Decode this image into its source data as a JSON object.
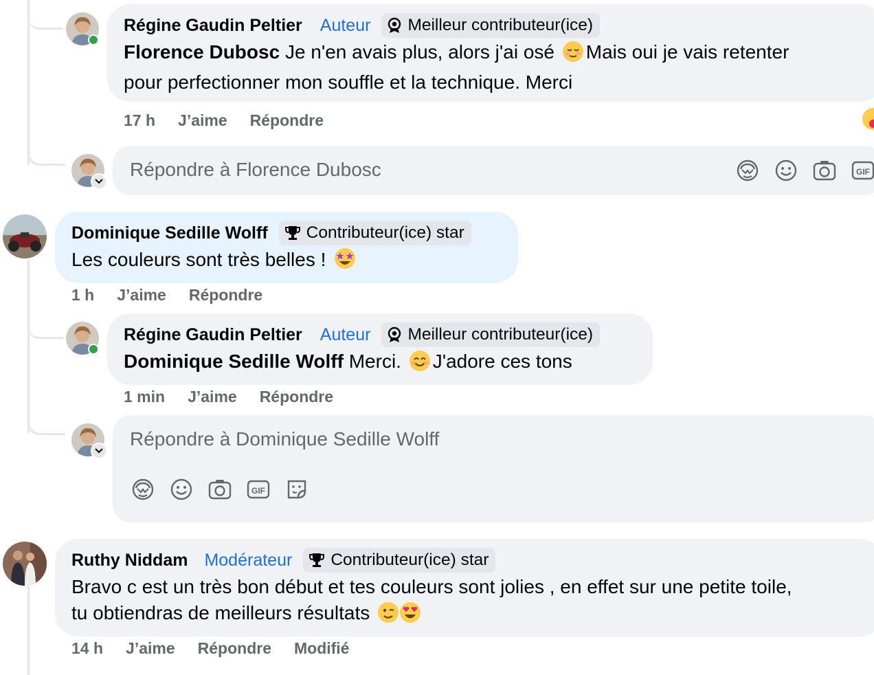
{
  "thread": [
    {
      "author": "Régine Gaudin Peltier",
      "role": "Auteur",
      "badge": "Meilleur contributeur(ice)",
      "mention": "Florence Dubosc",
      "text_1": "Je n'en avais plus, alors j'ai osé",
      "text_2": "Mais oui je vais retenter",
      "text_3": "pour perfectionner mon souffle et la technique. Merci",
      "time": "17 h",
      "like": "J’aime",
      "reply": "Répondre"
    },
    {
      "reply_placeholder": "Répondre à Florence Dubosc"
    },
    {
      "author": "Dominique Sedille Wolff",
      "badge": "Contributeur(ice) star",
      "text": "Les couleurs sont très belles !",
      "time": "1 h",
      "like": "J’aime",
      "reply": "Répondre"
    },
    {
      "author": "Régine Gaudin Peltier",
      "role": "Auteur",
      "badge": "Meilleur contributeur(ice)",
      "mention": "Dominique Sedille Wolff",
      "text_1": "Merci.",
      "text_2": "J'adore ces tons",
      "time": "1 min",
      "like": "J’aime",
      "reply": "Répondre"
    },
    {
      "reply_placeholder": "Répondre à Dominique Sedille Wolff"
    },
    {
      "author": "Ruthy Niddam",
      "role": "Modérateur",
      "badge": "Contributeur(ice) star",
      "text_1": "Bravo c est un très bon début et tes couleurs sont jolies , en effet sur une petite toile,",
      "text_2": "tu obtiendras de meilleurs résultats",
      "time": "14 h",
      "like": "J’aime",
      "reply": "Répondre",
      "edited": "Modifié"
    }
  ],
  "colors": {
    "bubble": "#f0f2f5",
    "bubble_highlight": "#e7f3ff",
    "role_blue": "#216fdb",
    "meta_grey": "#65676b",
    "online_green": "#31a24c"
  },
  "icons": [
    "avatar-sticker-icon",
    "smiley-icon",
    "camera-icon",
    "gif-icon",
    "sticker-icon",
    "medal-icon",
    "trophy-icon",
    "chevron-down-icon"
  ]
}
